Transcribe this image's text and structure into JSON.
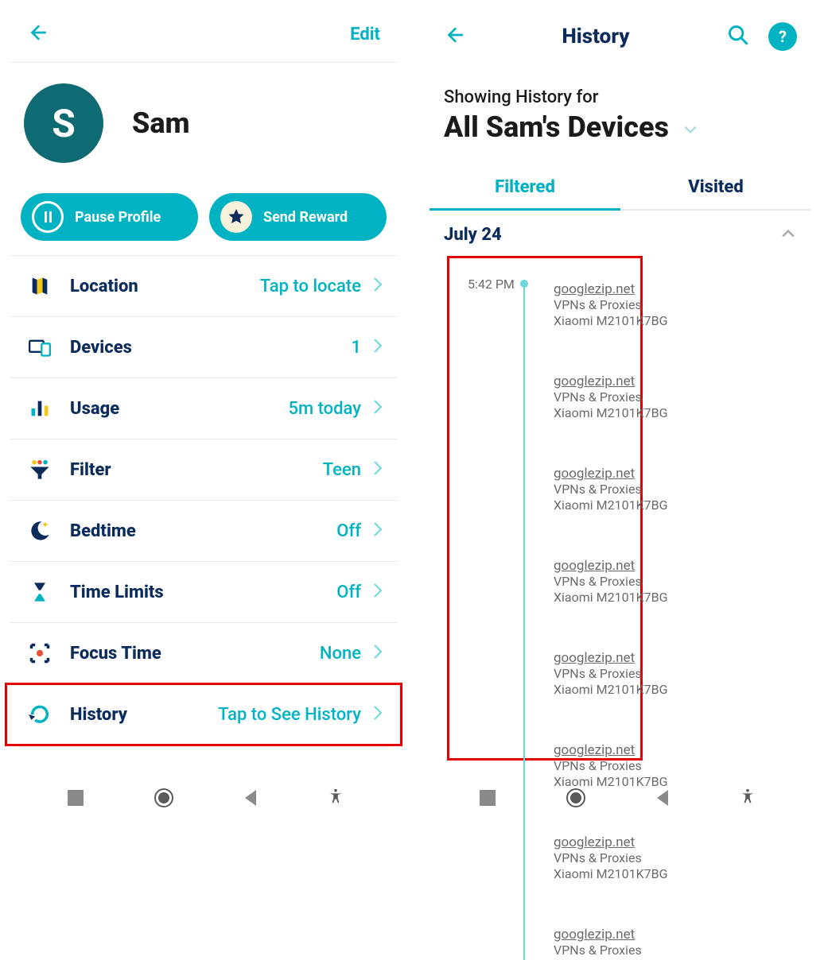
{
  "left": {
    "header": {
      "edit": "Edit"
    },
    "profile": {
      "initial": "S",
      "name": "Sam"
    },
    "actions": {
      "pause": "Pause Profile",
      "reward": "Send Reward"
    },
    "rows": {
      "location": {
        "label": "Location",
        "value": "Tap to locate"
      },
      "devices": {
        "label": "Devices",
        "value": "1"
      },
      "usage": {
        "label": "Usage",
        "value": "5m today"
      },
      "filter": {
        "label": "Filter",
        "value": "Teen"
      },
      "bedtime": {
        "label": "Bedtime",
        "value": "Off"
      },
      "timelimits": {
        "label": "Time Limits",
        "value": "Off"
      },
      "focustime": {
        "label": "Focus Time",
        "value": "None"
      },
      "history": {
        "label": "History",
        "value": "Tap to See History"
      }
    }
  },
  "right": {
    "header": {
      "title": "History",
      "help": "?"
    },
    "showing_label": "Showing History for",
    "scope": "All Sam's Devices",
    "tabs": {
      "filtered": "Filtered",
      "visited": "Visited"
    },
    "date": "July 24",
    "time": "5:42 PM",
    "entries": [
      {
        "domain": "googlezip.net",
        "category": "VPNs & Proxies",
        "device": "Xiaomi M2101K7BG"
      },
      {
        "domain": "googlezip.net",
        "category": "VPNs & Proxies",
        "device": "Xiaomi M2101K7BG"
      },
      {
        "domain": "googlezip.net",
        "category": "VPNs & Proxies",
        "device": "Xiaomi M2101K7BG"
      },
      {
        "domain": "googlezip.net",
        "category": "VPNs & Proxies",
        "device": "Xiaomi M2101K7BG"
      },
      {
        "domain": "googlezip.net",
        "category": "VPNs & Proxies",
        "device": "Xiaomi M2101K7BG"
      },
      {
        "domain": "googlezip.net",
        "category": "VPNs & Proxies",
        "device": "Xiaomi M2101K7BG"
      },
      {
        "domain": "googlezip.net",
        "category": "VPNs & Proxies",
        "device": "Xiaomi M2101K7BG"
      },
      {
        "domain": "googlezip.net",
        "category": "VPNs & Proxies",
        "device": ""
      }
    ]
  }
}
